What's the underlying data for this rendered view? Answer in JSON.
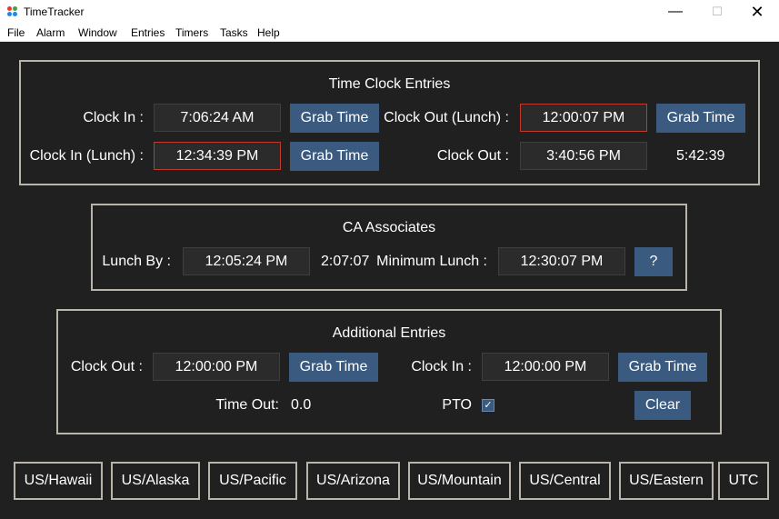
{
  "window": {
    "title": "TimeTracker"
  },
  "menu": [
    "File",
    "Alarm",
    "Window",
    "Entries",
    "Timers",
    "Tasks",
    "Help"
  ],
  "time_clock": {
    "title": "Time Clock Entries",
    "clock_in_label": "Clock In :",
    "clock_in_value": "7:06:24 AM",
    "clock_in_lunch_label": "Clock In (Lunch) :",
    "clock_in_lunch_value": "12:34:39 PM",
    "clock_out_lunch_label": "Clock Out (Lunch) :",
    "clock_out_lunch_value": "12:00:07 PM",
    "clock_out_label": "Clock Out :",
    "clock_out_value": "3:40:56 PM",
    "total": "5:42:39",
    "grab_time": "Grab Time"
  },
  "ca_associates": {
    "title": "CA Associates",
    "lunch_by_label": "Lunch By :",
    "lunch_by_value": "12:05:24 PM",
    "elapsed": "2:07:07",
    "minimum_lunch_label": "Minimum Lunch :",
    "minimum_lunch_value": "12:30:07 PM",
    "help_label": "?"
  },
  "additional": {
    "title": "Additional Entries",
    "clock_out_label": "Clock Out :",
    "clock_out_value": "12:00:00 PM",
    "clock_in_label": "Clock In :",
    "clock_in_value": "12:00:00 PM",
    "grab_time": "Grab Time",
    "time_out_label": "Time Out:",
    "time_out_value": "0.0",
    "pto_label": "PTO",
    "pto_checked": true,
    "clear_label": "Clear"
  },
  "timezones": [
    "US/Hawaii",
    "US/Alaska",
    "US/Pacific",
    "US/Arizona",
    "US/Mountain",
    "US/Central",
    "US/Eastern",
    "UTC"
  ]
}
